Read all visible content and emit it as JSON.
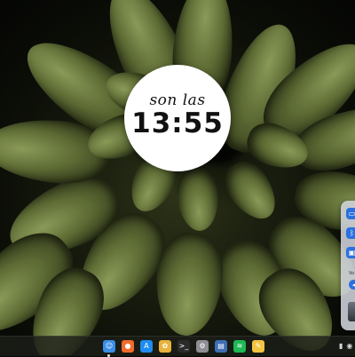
{
  "clock": {
    "caption": "son las",
    "time": "13:55"
  },
  "side_panel": {
    "buttons": [
      {
        "icon": "wifi-icon",
        "glyph": "▭",
        "color": "#2a70e0"
      },
      {
        "icon": "bluetooth-icon",
        "glyph": "ᛒ",
        "color": "#2a70e0"
      },
      {
        "icon": "display-icon",
        "glyph": "▣",
        "color": "#2a70e0"
      }
    ],
    "section_label": "Vo",
    "volume_icon": "speaker-icon"
  },
  "dock": {
    "apps": [
      {
        "name": "finder",
        "icon": "finder-icon",
        "glyph": "☺",
        "color": "#3a8ee6",
        "running": true
      },
      {
        "name": "firefox",
        "icon": "firefox-icon",
        "glyph": "●",
        "color": "#f26b2a",
        "running": false
      },
      {
        "name": "app-store",
        "icon": "app-store-icon",
        "glyph": "A",
        "color": "#1f8df0",
        "running": false
      },
      {
        "name": "photos",
        "icon": "photos-icon",
        "glyph": "✿",
        "color": "#e9b23c",
        "running": false
      },
      {
        "name": "terminal",
        "icon": "terminal-icon",
        "glyph": ">_",
        "color": "#2b2b2b",
        "running": false
      },
      {
        "name": "settings",
        "icon": "settings-icon",
        "glyph": "⚙",
        "color": "#8e8e93",
        "running": false
      },
      {
        "name": "remote-desktop",
        "icon": "remote-desktop-icon",
        "glyph": "▤",
        "color": "#3f6fb5",
        "running": false
      },
      {
        "name": "spotify",
        "icon": "spotify-icon",
        "glyph": "≋",
        "color": "#1db954",
        "running": false
      },
      {
        "name": "notes",
        "icon": "notes-icon",
        "glyph": "✎",
        "color": "#f4c542",
        "running": false
      }
    ],
    "tray": [
      {
        "icon": "microphone-icon",
        "glyph": "▮"
      },
      {
        "icon": "power-icon",
        "glyph": "◉"
      }
    ]
  }
}
